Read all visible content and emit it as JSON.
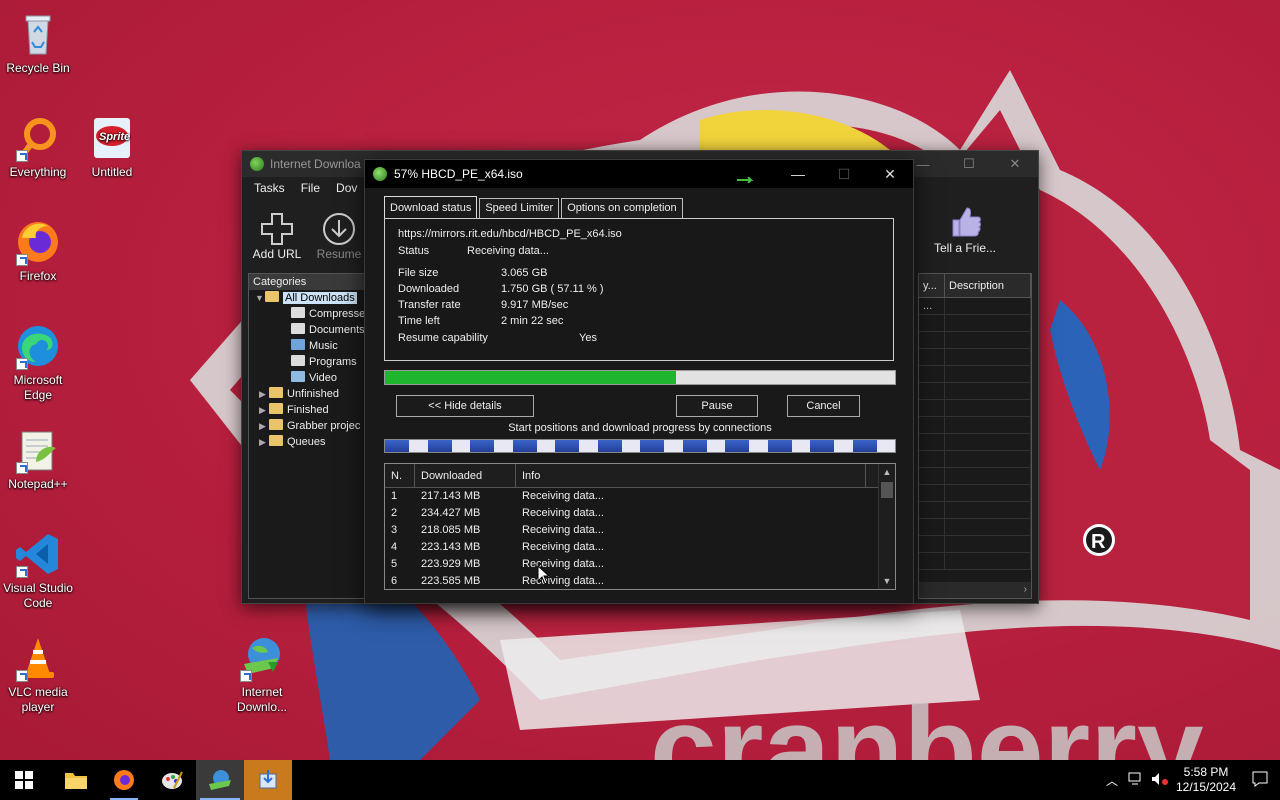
{
  "desktop": {
    "icons": [
      {
        "label": "Recycle Bin"
      },
      {
        "label": "Everything"
      },
      {
        "label": "Untitled"
      },
      {
        "label": "Firefox"
      },
      {
        "label": "Microsoft Edge"
      },
      {
        "label": "Notepad++"
      },
      {
        "label": "Visual Studio Code"
      },
      {
        "label": "VLC media player"
      },
      {
        "label": "Internet Downlo..."
      }
    ]
  },
  "idm_main": {
    "title": "Internet Downloa",
    "menu": [
      "Tasks",
      "File",
      "Dov"
    ],
    "toolbar": {
      "add_url": "Add URL",
      "resume": "Resume",
      "tell_friend": "Tell a Frie..."
    },
    "categories": {
      "header": "Categories",
      "items": [
        "All Downloads",
        "Compresse",
        "Documents",
        "Music",
        "Programs",
        "Video",
        "Unfinished",
        "Finished",
        "Grabber projec",
        "Queues"
      ]
    },
    "list": {
      "col_partial": "y...",
      "col_description": "Description",
      "row_partial": "..."
    }
  },
  "dialog": {
    "title": "57% HBCD_PE_x64.iso",
    "tabs": [
      "Download status",
      "Speed Limiter",
      "Options on completion"
    ],
    "url": "https://mirrors.rit.edu/hbcd/HBCD_PE_x64.iso",
    "status_label": "Status",
    "status_value": "Receiving data...",
    "file_size_label": "File size",
    "file_size_value": "3.065  GB",
    "downloaded_label": "Downloaded",
    "downloaded_value": "1.750  GB  ( 57.11 % )",
    "transfer_rate_label": "Transfer rate",
    "transfer_rate_value": "9.917  MB/sec",
    "time_left_label": "Time left",
    "time_left_value": "2 min 22 sec",
    "resume_label": "Resume capability",
    "resume_value": "Yes",
    "progress": 0.5711,
    "buttons": {
      "hide_details": "<< Hide details",
      "pause": "Pause",
      "cancel": "Cancel"
    },
    "connections_label": "Start positions and download progress by connections",
    "connections_table": {
      "headers": [
        "N.",
        "Downloaded",
        "Info"
      ],
      "rows": [
        {
          "n": "1",
          "downloaded": "217.143  MB",
          "info": "Receiving data..."
        },
        {
          "n": "2",
          "downloaded": "234.427  MB",
          "info": "Receiving data..."
        },
        {
          "n": "3",
          "downloaded": "218.085  MB",
          "info": "Receiving data..."
        },
        {
          "n": "4",
          "downloaded": "223.143  MB",
          "info": "Receiving data..."
        },
        {
          "n": "5",
          "downloaded": "223.929  MB",
          "info": "Receiving data..."
        },
        {
          "n": "6",
          "downloaded": "223.585  MB",
          "info": "Receiving data..."
        }
      ]
    }
  },
  "taskbar": {
    "time": "5:58 PM",
    "date": "12/15/2024"
  },
  "colors": {
    "wallpaper": "#b8223f",
    "progress_fill": "#1fb52e",
    "connection_blue": "#3a63c8"
  }
}
